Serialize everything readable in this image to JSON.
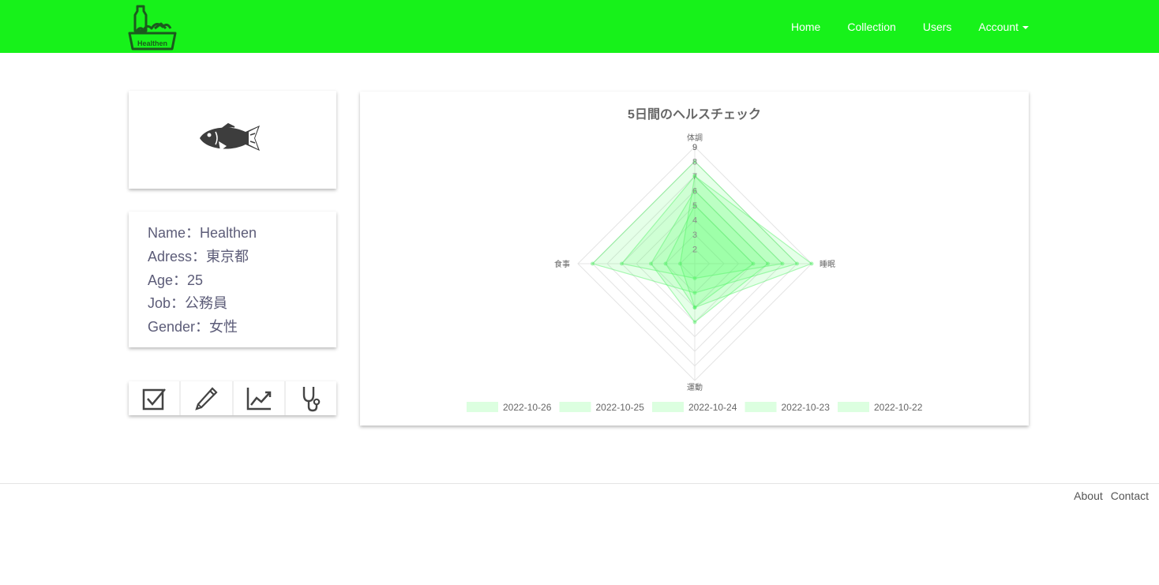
{
  "brand": {
    "logo_text": "Healthen"
  },
  "nav": {
    "home": "Home",
    "collection": "Collection",
    "users": "Users",
    "account": "Account"
  },
  "profile": {
    "name": "Name：Healthen",
    "address": "Adress：東京都",
    "age": "Age：25",
    "job": "Job：公務員",
    "gender": "Gender：女性"
  },
  "actions": [
    {
      "icon": "checkbox-icon"
    },
    {
      "icon": "pencil-icon"
    },
    {
      "icon": "line-chart-icon"
    },
    {
      "icon": "stethoscope-icon"
    }
  ],
  "chart_data": {
    "type": "radar",
    "title": "5日間のヘルスチェック",
    "axes": [
      "体調",
      "睡眠",
      "運動",
      "食事"
    ],
    "r_ticks": [
      "2",
      "3",
      "4",
      "5",
      "6",
      "7",
      "8",
      "9"
    ],
    "r_min": 1,
    "r_max": 9,
    "series": [
      {
        "name": "2022-10-26",
        "values": [
          8,
          8,
          3,
          8
        ]
      },
      {
        "name": "2022-10-25",
        "values": [
          7,
          7,
          2,
          6
        ]
      },
      {
        "name": "2022-10-24",
        "values": [
          6,
          6,
          5,
          4
        ]
      },
      {
        "name": "2022-10-23",
        "values": [
          5,
          5,
          4,
          3
        ]
      },
      {
        "name": "2022-10-22",
        "values": [
          7,
          9,
          4,
          2
        ]
      }
    ],
    "colors": {
      "fill": "rgba(80,255,100,0.15)",
      "stroke": "rgba(80,240,100,0.45)",
      "grid": "#e4e4e4",
      "legend_box": "#dcffe0"
    },
    "legend_position": "bottom"
  },
  "footer": {
    "about": "About",
    "contact": "Contact"
  }
}
